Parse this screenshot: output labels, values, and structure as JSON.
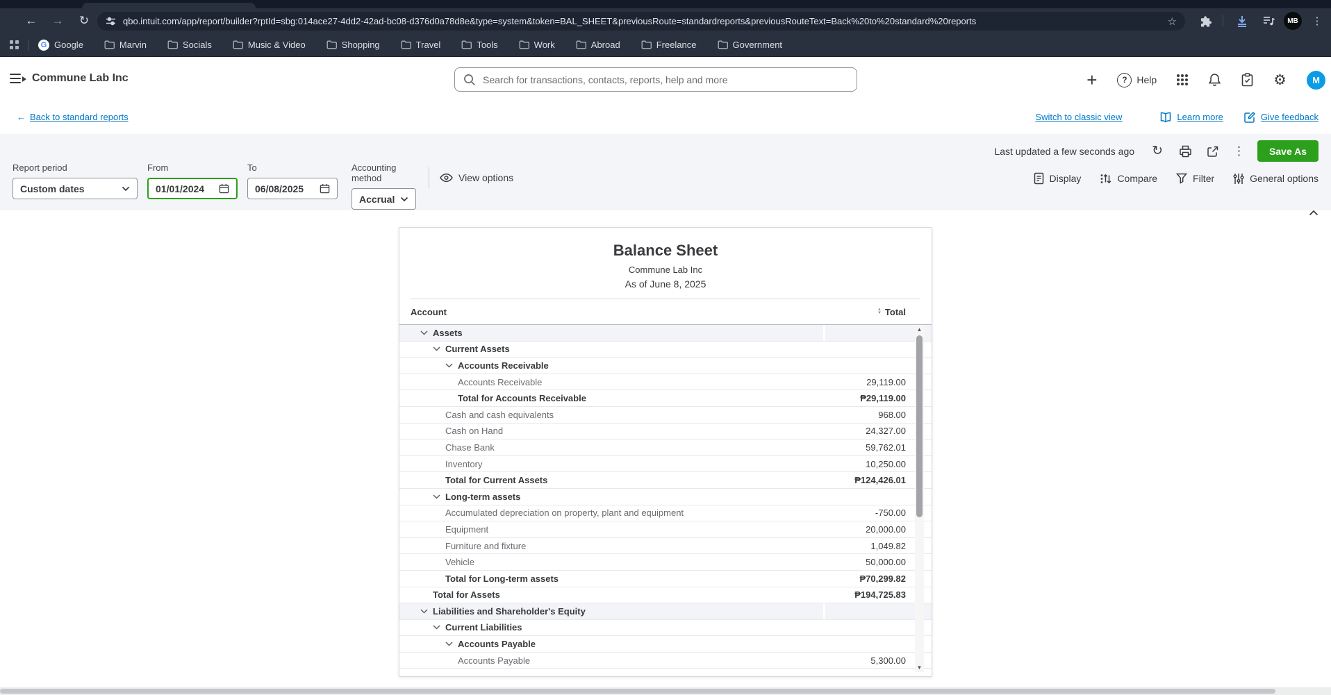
{
  "browser": {
    "url": "qbo.intuit.com/app/report/builder?rptId=sbg:014ace27-4dd2-42ad-bc08-d376d0a78d8e&type=system&token=BAL_SHEET&previousRoute=standardreports&previousRouteText=Back%20to%20standard%20reports",
    "profile_initials": "MB",
    "bookmarks": [
      "Google",
      "Marvin",
      "Socials",
      "Music & Video",
      "Shopping",
      "Travel",
      "Tools",
      "Work",
      "Abroad",
      "Freelance",
      "Government"
    ]
  },
  "header": {
    "company": "Commune Lab Inc",
    "search_placeholder": "Search for transactions, contacts, reports, help and more",
    "help_label": "Help",
    "avatar_initial": "M"
  },
  "subheader": {
    "back_link": "Back to standard reports",
    "switch_link": "Switch to classic view",
    "learn_more": "Learn more",
    "give_feedback": "Give feedback"
  },
  "toolbar": {
    "last_updated": "Last updated a few seconds ago",
    "save_as_label": "Save As"
  },
  "filters": {
    "report_period": {
      "label": "Report period",
      "value": "Custom dates"
    },
    "from": {
      "label": "From",
      "value": "01/01/2024"
    },
    "to": {
      "label": "To",
      "value": "06/08/2025"
    },
    "accounting_method": {
      "label": "Accounting method",
      "value": "Accrual"
    },
    "view_options_label": "View options"
  },
  "report_actions": {
    "display": "Display",
    "compare": "Compare",
    "filter": "Filter",
    "general_options": "General options"
  },
  "colors": {
    "qbo_green": "#2ca01c",
    "qbo_blue": "#0077c5",
    "avatar_blue": "#0a9ce4"
  },
  "report": {
    "title": "Balance Sheet",
    "company": "Commune Lab Inc",
    "as_of": "As of June 8, 2025",
    "columns": {
      "account": "Account",
      "total": "Total"
    },
    "rows": [
      {
        "label": "Assets",
        "value": "",
        "level": 0,
        "chevron": true,
        "bold": true,
        "section": true
      },
      {
        "label": "Current Assets",
        "value": "",
        "level": 1,
        "chevron": true,
        "bold": true,
        "section": false
      },
      {
        "label": "Accounts Receivable",
        "value": "",
        "level": 2,
        "chevron": true,
        "bold": true,
        "section": false
      },
      {
        "label": "Accounts Receivable",
        "value": "29,119.00",
        "level": 2,
        "chevron": false,
        "bold": false,
        "section": false
      },
      {
        "label": "Total for Accounts Receivable",
        "value": "₱29,119.00",
        "level": 2,
        "chevron": false,
        "bold": true,
        "section": false
      },
      {
        "label": "Cash and cash equivalents",
        "value": "968.00",
        "level": 1,
        "chevron": false,
        "bold": false,
        "section": false
      },
      {
        "label": "Cash on Hand",
        "value": "24,327.00",
        "level": 1,
        "chevron": false,
        "bold": false,
        "section": false
      },
      {
        "label": "Chase Bank",
        "value": "59,762.01",
        "level": 1,
        "chevron": false,
        "bold": false,
        "section": false
      },
      {
        "label": "Inventory",
        "value": "10,250.00",
        "level": 1,
        "chevron": false,
        "bold": false,
        "section": false
      },
      {
        "label": "Total for Current Assets",
        "value": "₱124,426.01",
        "level": 1,
        "chevron": false,
        "bold": true,
        "section": false
      },
      {
        "label": "Long-term assets",
        "value": "",
        "level": 1,
        "chevron": true,
        "bold": true,
        "section": false
      },
      {
        "label": "Accumulated depreciation on property, plant and equipment",
        "value": "-750.00",
        "level": 1,
        "chevron": false,
        "bold": false,
        "section": false
      },
      {
        "label": "Equipment",
        "value": "20,000.00",
        "level": 1,
        "chevron": false,
        "bold": false,
        "section": false
      },
      {
        "label": "Furniture and fixture",
        "value": "1,049.82",
        "level": 1,
        "chevron": false,
        "bold": false,
        "section": false
      },
      {
        "label": "Vehicle",
        "value": "50,000.00",
        "level": 1,
        "chevron": false,
        "bold": false,
        "section": false
      },
      {
        "label": "Total for Long-term assets",
        "value": "₱70,299.82",
        "level": 1,
        "chevron": false,
        "bold": true,
        "section": false
      },
      {
        "label": "Total for Assets",
        "value": "₱194,725.83",
        "level": 0,
        "chevron": false,
        "bold": true,
        "section": false
      },
      {
        "label": "Liabilities and Shareholder's Equity",
        "value": "",
        "level": 0,
        "chevron": true,
        "bold": true,
        "section": true
      },
      {
        "label": "Current Liabilities",
        "value": "",
        "level": 1,
        "chevron": true,
        "bold": true,
        "section": false
      },
      {
        "label": "Accounts Payable",
        "value": "",
        "level": 2,
        "chevron": true,
        "bold": true,
        "section": false
      },
      {
        "label": "Accounts Payable",
        "value": "5,300.00",
        "level": 2,
        "chevron": false,
        "bold": false,
        "section": false
      }
    ]
  }
}
